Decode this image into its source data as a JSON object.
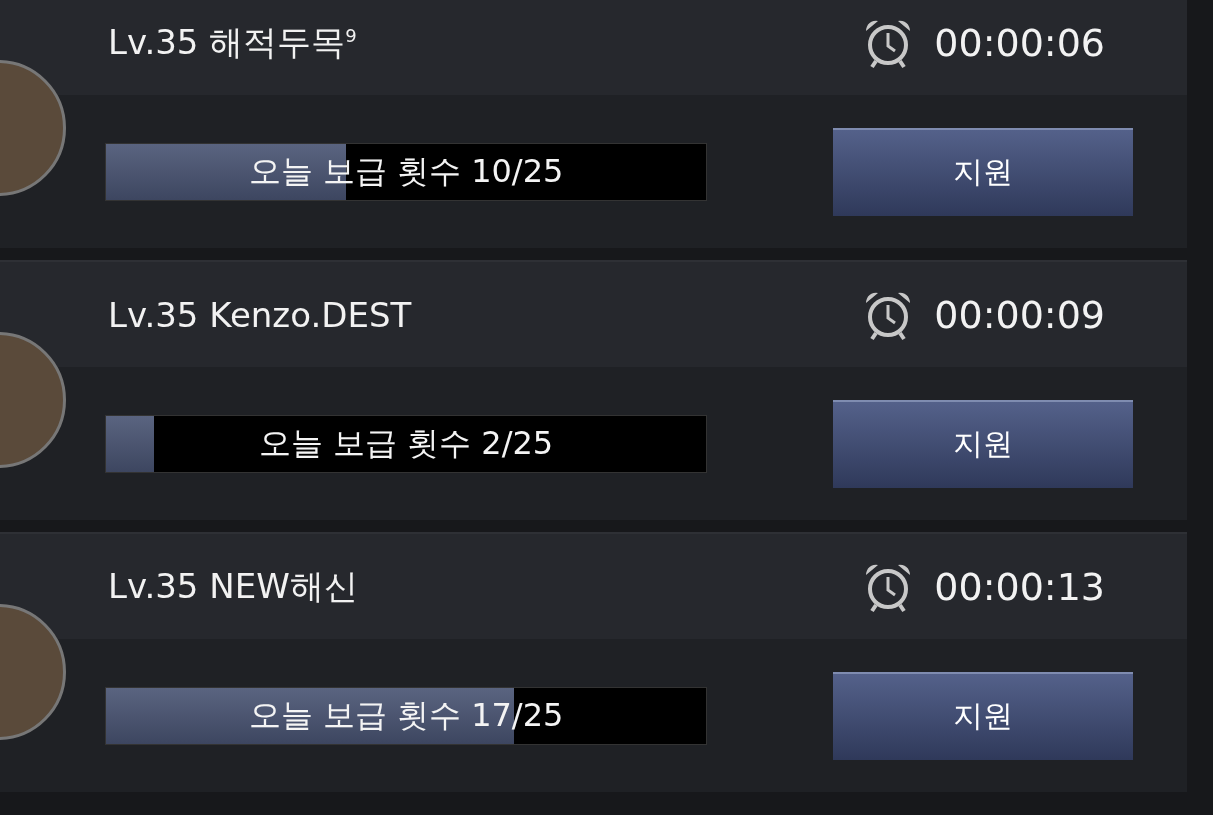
{
  "requests": [
    {
      "name": "Lv.35 해적두목$^{9}$",
      "timer": "00:00:06",
      "supply": "오늘 보급 횟수 10/25",
      "level": 0.4,
      "button": "지원"
    },
    {
      "name": "Lv.35 Kenzo.DEST",
      "timer": "00:00:09",
      "supply": "오늘 보급 횟수 2/25",
      "level": 0.08,
      "button": "지원"
    },
    {
      "name": "Lv.35 NEW해신",
      "timer": "00:00:13",
      "supply": "오늘 보급 횟수 17/25",
      "level": 0.68,
      "button": "지원"
    }
  ]
}
